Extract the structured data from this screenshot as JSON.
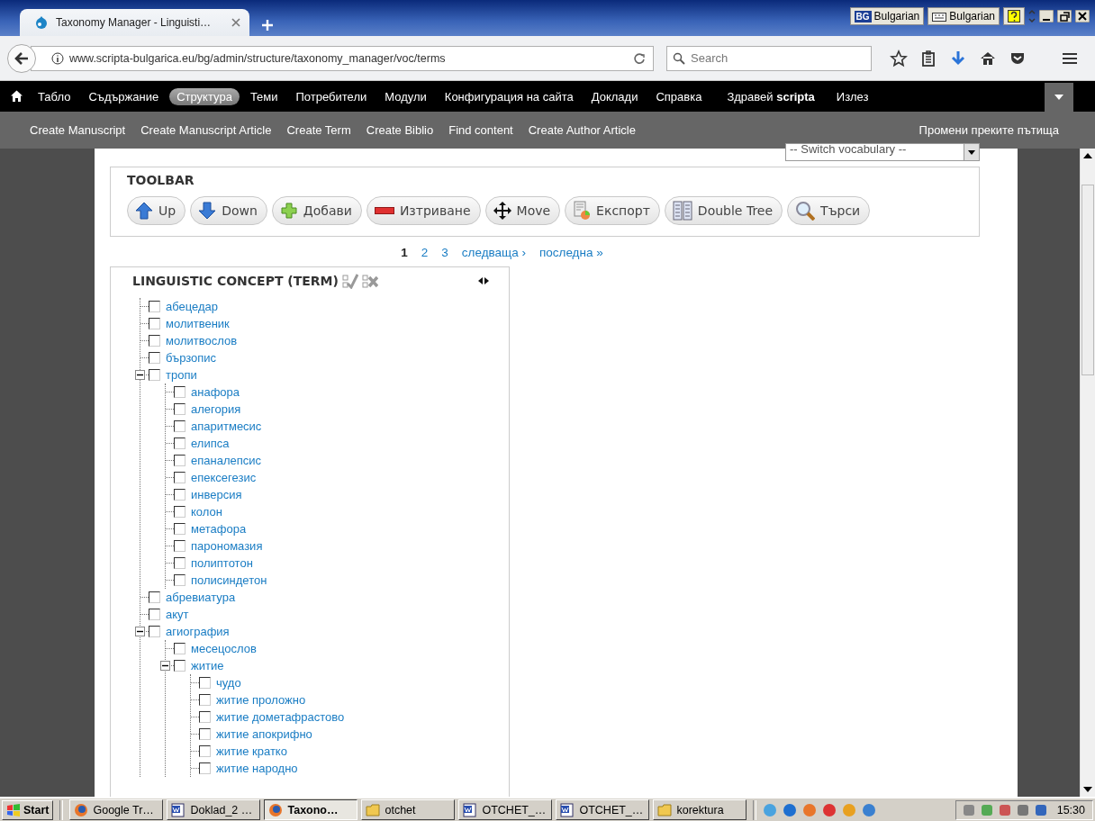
{
  "browser": {
    "tabs": [
      {
        "title": "Taxonomy Manager - Linguisti…",
        "selected": true
      }
    ],
    "language_bar": {
      "code": "BG",
      "input": "Bulgarian",
      "keyboard": "Bulgarian"
    },
    "url": "www.scripta-bulgarica.eu/bg/admin/structure/taxonomy_manager/voc/terms",
    "search": {
      "placeholder": "Search"
    }
  },
  "admin_menu": [
    {
      "label": "Табло",
      "selected": false
    },
    {
      "label": "Съдържание",
      "selected": false
    },
    {
      "label": "Структура",
      "selected": true
    },
    {
      "label": "Теми",
      "selected": false
    },
    {
      "label": "Потребители",
      "selected": false
    },
    {
      "label": "Модули",
      "selected": false
    },
    {
      "label": "Конфигурация на сайта",
      "selected": false
    },
    {
      "label": "Доклади",
      "selected": false
    },
    {
      "label": "Справка",
      "selected": false
    }
  ],
  "greeting": "Здравей **scripta**",
  "logout": "Излез",
  "shortcuts": [
    "Create Manuscript",
    "Create Manuscript Article",
    "Create Term",
    "Create Biblio",
    "Find content",
    "Create Author Article"
  ],
  "shortcuts_edit": "Промени преките пътища",
  "vocabulary_switch": "-- Switch vocabulary --",
  "toolbar": {
    "title": "TOOLBAR",
    "buttons": [
      {
        "label": "Up",
        "kind": "up"
      },
      {
        "label": "Down",
        "kind": "down"
      },
      {
        "label": "Добави",
        "kind": "add"
      },
      {
        "label": "Изтриване",
        "kind": "delete"
      },
      {
        "label": "Move",
        "kind": "move"
      },
      {
        "label": "Експорт",
        "kind": "export"
      },
      {
        "label": "Double Tree",
        "kind": "double"
      },
      {
        "label": "Търси",
        "kind": "search"
      }
    ]
  },
  "pager": [
    {
      "label": "1",
      "selected": true
    },
    {
      "label": "2",
      "selected": false
    },
    {
      "label": "3",
      "selected": false
    },
    {
      "label": "следваща ›",
      "selected": false
    },
    {
      "label": "последна »",
      "selected": false
    }
  ],
  "tree": {
    "title": "LINGUISTIC CONCEPT (TERM)",
    "items": [
      {
        "label": "абецедар",
        "checked": false
      },
      {
        "label": "молитвеник",
        "checked": false
      },
      {
        "label": "молитвослов",
        "checked": false
      },
      {
        "label": "бързопис",
        "checked": false
      },
      {
        "label": "тропи",
        "checked": false,
        "expanded": true,
        "children": [
          {
            "label": "анафора",
            "checked": false
          },
          {
            "label": "алегория",
            "checked": false
          },
          {
            "label": "апаритмесис",
            "checked": false
          },
          {
            "label": "елипса",
            "checked": false
          },
          {
            "label": "епаналепсис",
            "checked": false
          },
          {
            "label": "епексегезис",
            "checked": false
          },
          {
            "label": "инверсия",
            "checked": false
          },
          {
            "label": "колон",
            "checked": false
          },
          {
            "label": "метафора",
            "checked": false
          },
          {
            "label": "парономазия",
            "checked": false
          },
          {
            "label": "полиптотон",
            "checked": false
          },
          {
            "label": "полисиндетон",
            "checked": false
          }
        ]
      },
      {
        "label": "абревиатура",
        "checked": false
      },
      {
        "label": "акут",
        "checked": false
      },
      {
        "label": "агиография",
        "checked": false,
        "expanded": true,
        "children": [
          {
            "label": "месецослов",
            "checked": false
          },
          {
            "label": "житие",
            "checked": false,
            "expanded": true,
            "children": [
              {
                "label": "чудо",
                "checked": false
              },
              {
                "label": "житие проложно",
                "checked": false
              },
              {
                "label": "житие дометафрастово",
                "checked": false
              },
              {
                "label": "житие апокрифно",
                "checked": false
              },
              {
                "label": "житие кратко",
                "checked": false
              },
              {
                "label": "житие народно",
                "checked": false
              }
            ]
          }
        ]
      }
    ]
  },
  "taskbar": {
    "start": "Start",
    "items": [
      {
        "label": "Google Tr…",
        "kind": "firefox",
        "selected": false
      },
      {
        "label": "Doklad_2 …",
        "kind": "word",
        "selected": false
      },
      {
        "label": "Taxono…",
        "kind": "firefox",
        "selected": true
      },
      {
        "label": "otchet",
        "kind": "folder",
        "selected": false
      },
      {
        "label": "OTCHET_…",
        "kind": "word",
        "selected": false
      },
      {
        "label": "OTCHET_…",
        "kind": "word",
        "selected": false
      },
      {
        "label": "korektura",
        "kind": "folder",
        "selected": false
      }
    ],
    "clock": "15:30"
  }
}
